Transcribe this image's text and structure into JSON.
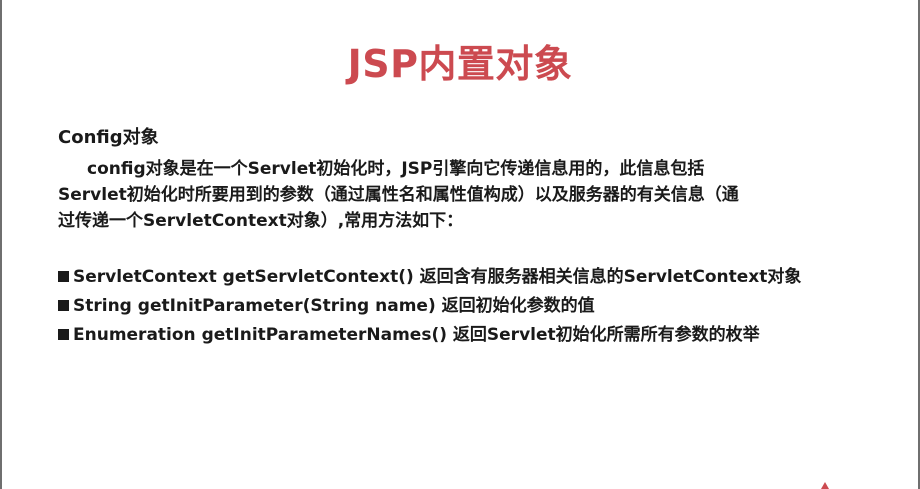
{
  "slide": {
    "title": "JSP内置对象",
    "section_heading": "Config对象",
    "intro_lines": [
      "config对象是在一个Servlet初始化时，JSP引擎向它传递信息用的，此信息包括",
      "Servlet初始化时所要用到的参数（通过属性名和属性值构成）以及服务器的有关信息（通",
      "过传递一个ServletContext对象）,常用方法如下："
    ],
    "methods": [
      "ServletContext getServletContext() 返回含有服务器相关信息的ServletContext对象",
      "String getInitParameter(String name) 返回初始化参数的值",
      "Enumeration getInitParameterNames() 返回Servlet初始化所需所有参数的枚举"
    ]
  },
  "colors": {
    "title": "#cc4a50",
    "body_text": "#1a1a1a",
    "background": "#ffffff"
  },
  "icons": {
    "bullet": "black-square-bullet-icon"
  }
}
